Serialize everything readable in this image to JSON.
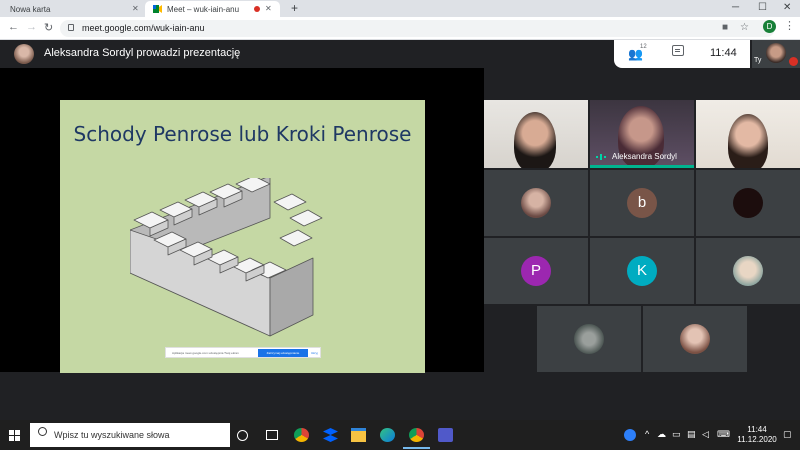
{
  "browser": {
    "tabs": [
      {
        "label": "Nowa karta"
      },
      {
        "label": "Meet – wuk-iain-anu"
      }
    ],
    "url": "meet.google.com/wuk-iain-anu",
    "profile_initial": "D"
  },
  "meet": {
    "presenter_text": "Aleksandra Sordyl prowadzi prezentację",
    "people_count": "12",
    "clock": "11:44",
    "self_label": "Ty",
    "slide_title": "Schody Penrose lub Kroki Penrose",
    "share_notice": "Aplikacja meet.google.com udostępnia Twój ekran",
    "share_stop": "Zatrzymaj udostępnianie",
    "share_hide": "Ukryj",
    "speaker_name": "Aleksandra Sordyl",
    "participants": [
      "b",
      "P",
      "K"
    ]
  },
  "taskbar": {
    "search_placeholder": "Wpisz tu wyszukiwane słowa",
    "time": "11:44",
    "date": "11.12.2020"
  },
  "colors": {
    "slide_bg": "#c5d8a4",
    "title_color": "#1f3864",
    "avatar_b": "#795548",
    "avatar_p": "#9c27b0",
    "avatar_k": "#00acc1",
    "speaking": "#00b38f"
  }
}
